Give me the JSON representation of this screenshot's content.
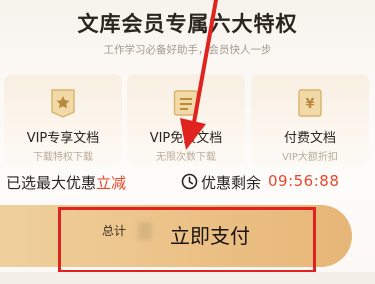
{
  "header": {
    "title": "文库会员专属六大特权",
    "subtitle": "工作学习必备好助手，会员快人一步"
  },
  "benefits": [
    {
      "icon": "star-document-icon",
      "title": "VIP专享文档",
      "subtitle": "下载特权下载"
    },
    {
      "icon": "free-ticket-icon",
      "title": "VIP免费文档",
      "subtitle": "无限次数下载"
    },
    {
      "icon": "yen-document-icon",
      "title": "付费文档",
      "subtitle": "VIP大额折扣"
    }
  ],
  "promo": {
    "prefix": "已选最大优惠",
    "highlight": "立减",
    "countdown_label": "优惠剩余",
    "countdown_time": "09:56:88"
  },
  "payment": {
    "total_label": "总计",
    "pay_button_label": "立即支付"
  },
  "colors": {
    "accent_red": "#e8472a",
    "annotation_red": "#e0231f",
    "gold": "#ecc186"
  }
}
